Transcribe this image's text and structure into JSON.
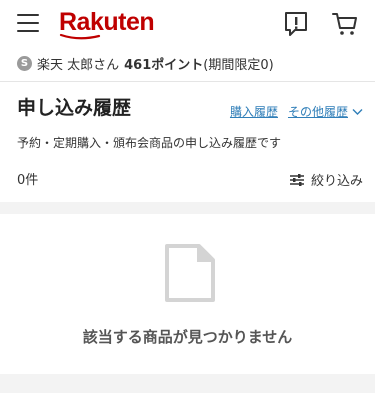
{
  "header": {
    "logo_text": "Rakuten",
    "brand_color": "#bf0000",
    "icons": [
      "menu-icon",
      "notice-icon",
      "cart-icon"
    ]
  },
  "points": {
    "coin_letter": "S",
    "user_name": "楽天 太郎さん",
    "points_value": "461ポイント",
    "limited": "(期間限定0)"
  },
  "page": {
    "title": "申し込み履歴",
    "link_purchase": "購入履歴",
    "link_other": "その他履歴",
    "description": "予約・定期購入・頒布会商品の申し込み履歴です"
  },
  "results": {
    "count": "0件",
    "filter_label": "絞り込み"
  },
  "empty": {
    "message": "該当する商品が見つかりません"
  },
  "colors": {
    "link": "#2f7eb8",
    "band": "#f3f3f3"
  }
}
